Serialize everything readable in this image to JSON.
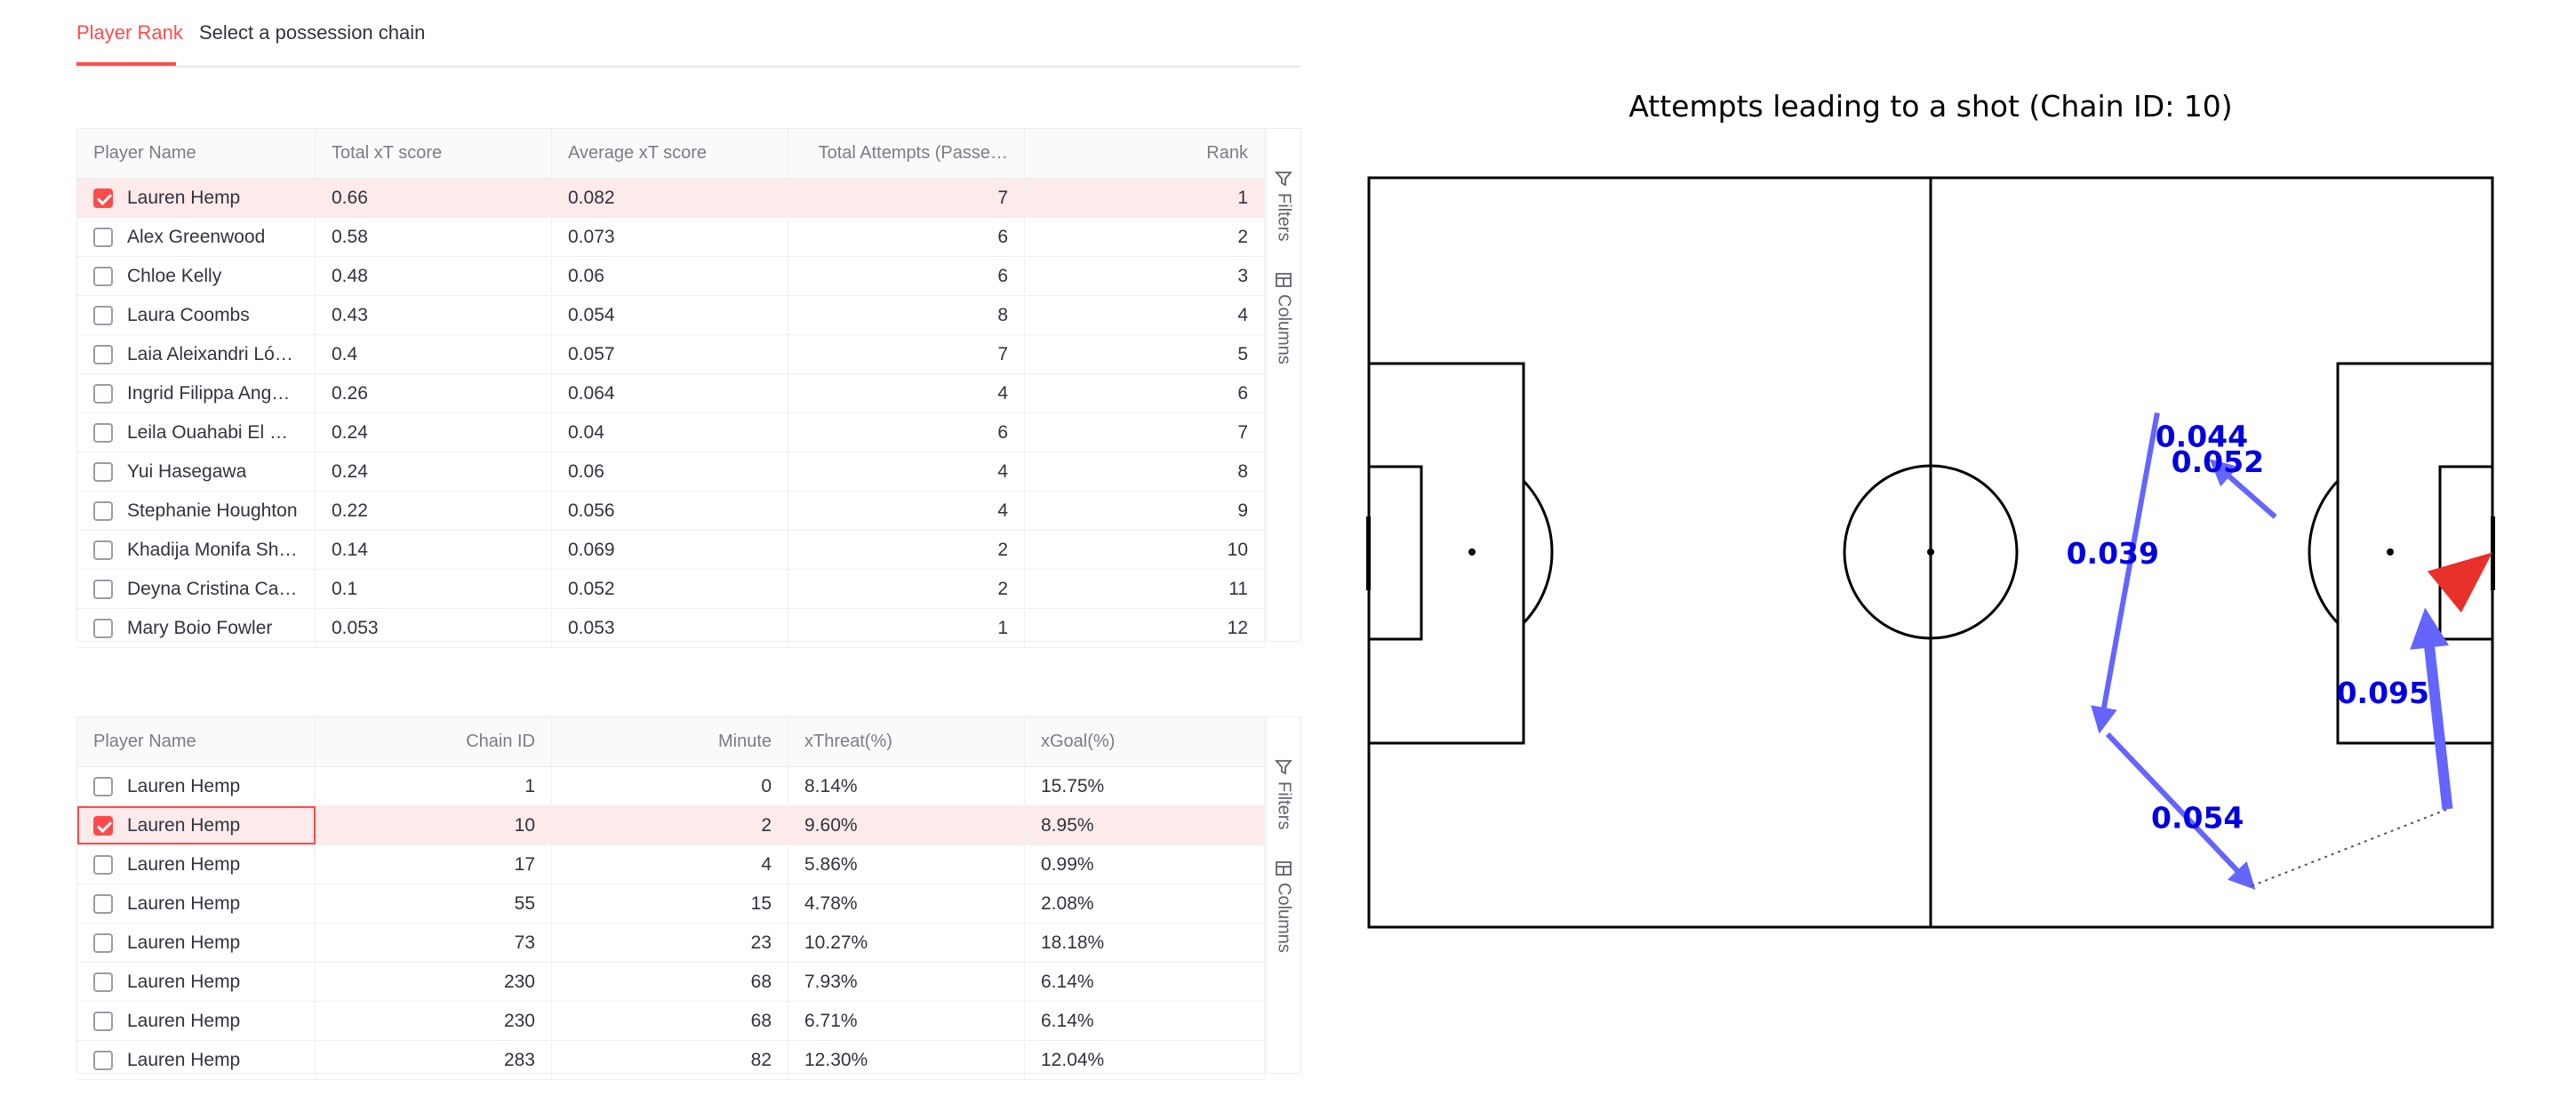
{
  "tabs": [
    {
      "label": "Player Rank",
      "active": true
    },
    {
      "label": "Select a possession chain",
      "active": false
    }
  ],
  "sidebar": {
    "filters_label": "Filters",
    "columns_label": "Columns"
  },
  "player_table": {
    "columns": [
      "Player Name",
      "Total xT score",
      "Average xT score",
      "Total Attempts (Passe…",
      "Rank"
    ],
    "rows": [
      {
        "selected": true,
        "cells": [
          "Lauren Hemp",
          "0.66",
          "0.082",
          "7",
          "1"
        ]
      },
      {
        "selected": false,
        "cells": [
          "Alex Greenwood",
          "0.58",
          "0.073",
          "6",
          "2"
        ]
      },
      {
        "selected": false,
        "cells": [
          "Chloe Kelly",
          "0.48",
          "0.06",
          "6",
          "3"
        ]
      },
      {
        "selected": false,
        "cells": [
          "Laura Coombs",
          "0.43",
          "0.054",
          "8",
          "4"
        ]
      },
      {
        "selected": false,
        "cells": [
          "Laia Aleixandri López",
          "0.4",
          "0.057",
          "7",
          "5"
        ]
      },
      {
        "selected": false,
        "cells": [
          "Ingrid Filippa Ange…",
          "0.26",
          "0.064",
          "4",
          "6"
        ]
      },
      {
        "selected": false,
        "cells": [
          "Leila Ouahabi El O…",
          "0.24",
          "0.04",
          "6",
          "7"
        ]
      },
      {
        "selected": false,
        "cells": [
          "Yui Hasegawa",
          "0.24",
          "0.06",
          "4",
          "8"
        ]
      },
      {
        "selected": false,
        "cells": [
          "Stephanie Houghton",
          "0.22",
          "0.056",
          "4",
          "9"
        ]
      },
      {
        "selected": false,
        "cells": [
          "Khadija Monifa Shaw",
          "0.14",
          "0.069",
          "2",
          "10"
        ]
      },
      {
        "selected": false,
        "cells": [
          "Deyna Cristina Cas…",
          "0.1",
          "0.052",
          "2",
          "11"
        ]
      },
      {
        "selected": false,
        "cells": [
          "Mary Boio Fowler",
          "0.053",
          "0.053",
          "1",
          "12"
        ]
      }
    ]
  },
  "chain_table": {
    "columns": [
      "Player Name",
      "Chain ID",
      "Minute",
      "xThreat(%)",
      "xGoal(%)"
    ],
    "rows": [
      {
        "selected": false,
        "cells": [
          "Lauren Hemp",
          "1",
          "0",
          "8.14%",
          "15.75%"
        ]
      },
      {
        "selected": true,
        "cells": [
          "Lauren Hemp",
          "10",
          "2",
          "9.60%",
          "8.95%"
        ]
      },
      {
        "selected": false,
        "cells": [
          "Lauren Hemp",
          "17",
          "4",
          "5.86%",
          "0.99%"
        ]
      },
      {
        "selected": false,
        "cells": [
          "Lauren Hemp",
          "55",
          "15",
          "4.78%",
          "2.08%"
        ]
      },
      {
        "selected": false,
        "cells": [
          "Lauren Hemp",
          "73",
          "23",
          "10.27%",
          "18.18%"
        ]
      },
      {
        "selected": false,
        "cells": [
          "Lauren Hemp",
          "230",
          "68",
          "7.93%",
          "6.14%"
        ]
      },
      {
        "selected": false,
        "cells": [
          "Lauren Hemp",
          "230",
          "68",
          "6.71%",
          "6.14%"
        ]
      },
      {
        "selected": false,
        "cells": [
          "Lauren Hemp",
          "283",
          "82",
          "12.30%",
          "12.04%"
        ]
      }
    ]
  },
  "chart_title": "Attempts leading to a shot (Chain ID: 10)",
  "chart_data": {
    "type": "pitch-arrows",
    "title": "Attempts leading to a shot (Chain ID: 10)",
    "pitch": {
      "length": 120,
      "width": 80
    },
    "actions": [
      {
        "label": "0.054",
        "kind": "pass",
        "start": [
          78.9,
          59.4
        ],
        "end": [
          94.3,
          75.6
        ]
      },
      {
        "label": "0.039",
        "kind": "pass",
        "start": [
          84.2,
          25.1
        ],
        "end": [
          78.1,
          58.8
        ]
      },
      {
        "label": "0.044",
        "kind": "pass",
        "start": [
          84.2,
          25.1
        ],
        "end": [
          84.2,
          25.1
        ]
      },
      {
        "label": "0.052",
        "kind": "pass",
        "start": [
          96.8,
          36.2
        ],
        "end": [
          90.2,
          30.4
        ]
      },
      {
        "label": "0.095",
        "kind": "carry",
        "start": [
          115.2,
          67.4
        ],
        "end": [
          112.8,
          45.9
        ]
      },
      {
        "label": "",
        "kind": "dribble",
        "start": [
          94.3,
          75.6
        ],
        "end": [
          115.2,
          67.4
        ]
      },
      {
        "label": "",
        "kind": "shot",
        "start": [
          112.8,
          45.9
        ],
        "end": [
          120,
          40
        ]
      }
    ],
    "colors": {
      "pass": "#6464ff",
      "label": "#0000e0",
      "shot": "#e8302a"
    }
  }
}
